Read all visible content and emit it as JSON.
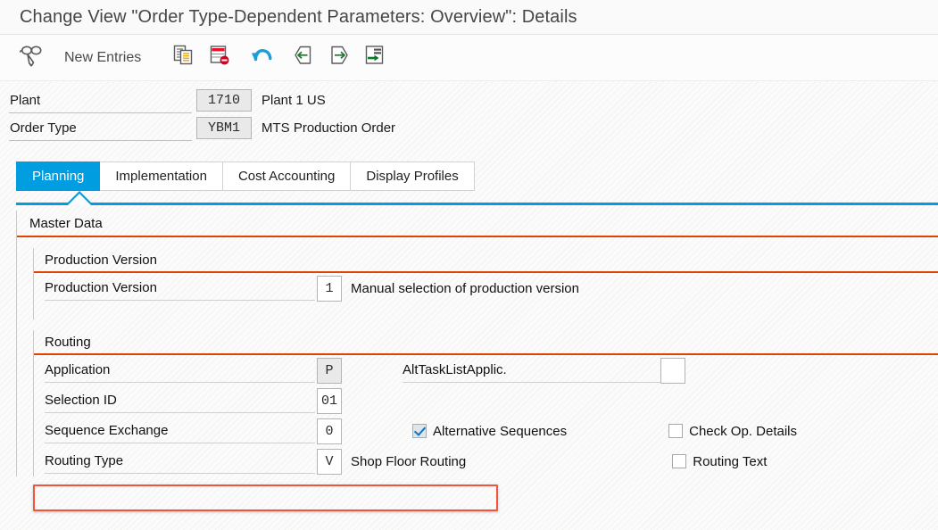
{
  "window": {
    "title": "Change View \"Order Type-Dependent Parameters: Overview\": Details"
  },
  "toolbar": {
    "display_change_icon": "glasses-pencil-icon",
    "new_entries_label": "New Entries",
    "copy_icon": "copy-as-icon",
    "delete_icon": "delete-row-icon",
    "undo_icon": "undo-icon",
    "previous_icon": "previous-entry-icon",
    "next_icon": "next-entry-icon",
    "details_icon": "other-entry-icon"
  },
  "header": {
    "fields": [
      {
        "label": "Plant",
        "value": "1710",
        "description": "Plant 1 US",
        "enabled": false
      },
      {
        "label": "Order Type",
        "value": "YBM1",
        "description": "MTS Production Order",
        "enabled": false
      }
    ]
  },
  "tabs": [
    {
      "label": "Planning",
      "active": true
    },
    {
      "label": "Implementation",
      "active": false
    },
    {
      "label": "Cost Accounting",
      "active": false
    },
    {
      "label": "Display Profiles",
      "active": false
    }
  ],
  "master_data": {
    "title": "Master Data",
    "production_version": {
      "title": "Production Version",
      "row": {
        "label": "Production Version",
        "value": "1",
        "description": "Manual selection of production version"
      }
    },
    "routing": {
      "title": "Routing",
      "application": {
        "label": "Application",
        "value": "P",
        "enabled": false
      },
      "alt_task_list_applic": {
        "label": "AltTaskListApplic.",
        "value": ""
      },
      "selection_id": {
        "label": "Selection ID",
        "value": "01"
      },
      "sequence_exchange": {
        "label": "Sequence Exchange",
        "value": "0"
      },
      "alternative_sequences": {
        "label": "Alternative Sequences",
        "checked": true
      },
      "check_op_details": {
        "label": "Check Op. Details",
        "checked": false
      },
      "routing_type": {
        "label": "Routing Type",
        "value": "V",
        "description": "Shop Floor Routing",
        "highlighted": true
      },
      "routing_text": {
        "label": "Routing Text",
        "checked": false
      }
    }
  },
  "colors": {
    "accent_blue": "#009de0",
    "section_orange": "#e04403",
    "highlight_red": "#f4543c"
  }
}
